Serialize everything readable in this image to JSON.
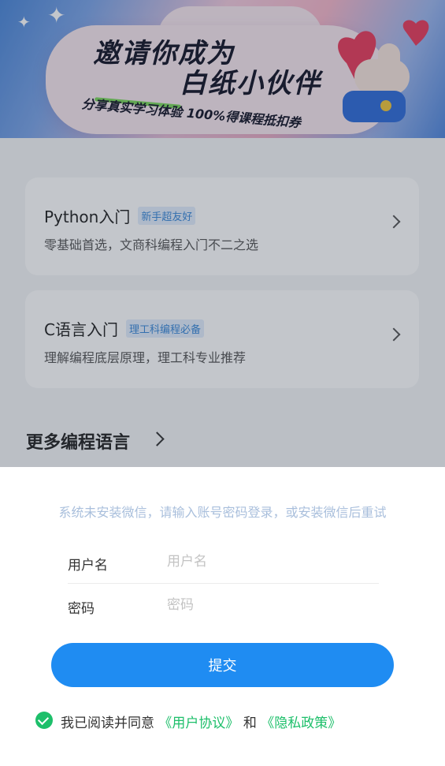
{
  "banner": {
    "title_line1": "邀请你成为",
    "title_line2": "白纸小伙伴",
    "subtitle": "分享真实学习体验 100%得课程抵扣券"
  },
  "courses": [
    {
      "title": "Python入门",
      "tag": "新手超友好",
      "desc": "零基础首选，文商科编程入门不二之选"
    },
    {
      "title": "C语言入门",
      "tag": "理工科编程必备",
      "desc": "理解编程底层原理，理工科专业推荐"
    }
  ],
  "more": {
    "label": "更多编程语言"
  },
  "login": {
    "notice": "系统未安装微信，请输入账号密码登录，或安装微信后重试",
    "username_label": "用户名",
    "username_placeholder": "用户名",
    "password_label": "密码",
    "password_placeholder": "密码",
    "submit_label": "提交",
    "agree_prefix": "我已阅读并同意",
    "user_agreement": "《用户协议》",
    "and": "和",
    "privacy_policy": "《隐私政策》"
  },
  "colors": {
    "primary": "#1f8cf2",
    "link_green": "#1dbf6a",
    "tag_blue": "#3a88d8"
  }
}
